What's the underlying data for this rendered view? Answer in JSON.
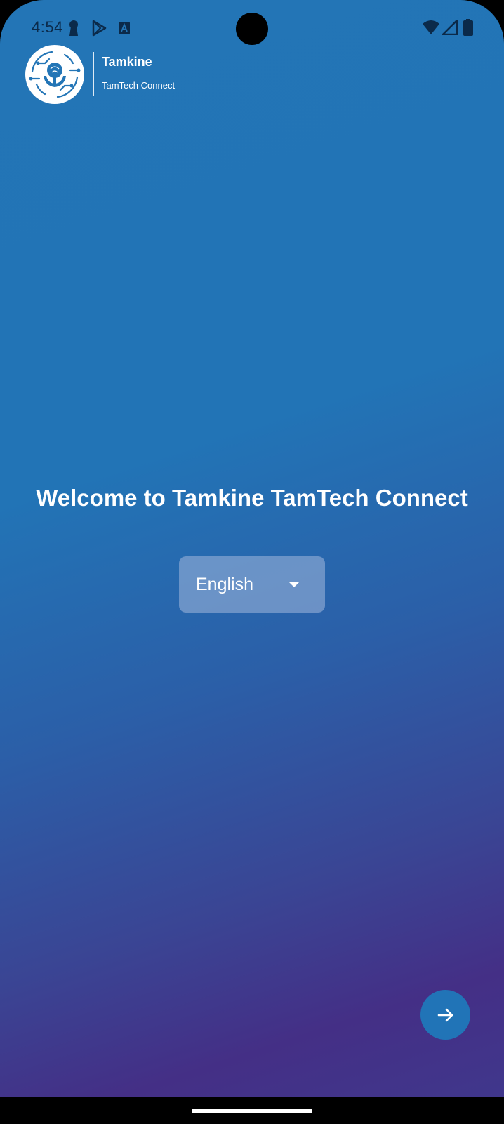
{
  "status_bar": {
    "time": "4:54",
    "left_icons": [
      "keyhole-icon",
      "play-store-icon",
      "font-a-icon"
    ],
    "right_icons": [
      "wifi-icon",
      "cell-signal-icon",
      "battery-icon"
    ]
  },
  "brand": {
    "name": "Tamkine",
    "subtitle": "TamTech Connect",
    "logo_icon": "tamkine-logo-icon"
  },
  "main": {
    "welcome_text": "Welcome to Tamkine TamTech Connect",
    "language_select": {
      "selected": "English",
      "caret_icon": "caret-down-icon"
    }
  },
  "next_button": {
    "icon": "arrow-right-icon",
    "color": "#2174b7"
  },
  "colors": {
    "gradient_top": "#2375b6",
    "gradient_bottom": "#442f86",
    "text": "#ffffff"
  }
}
